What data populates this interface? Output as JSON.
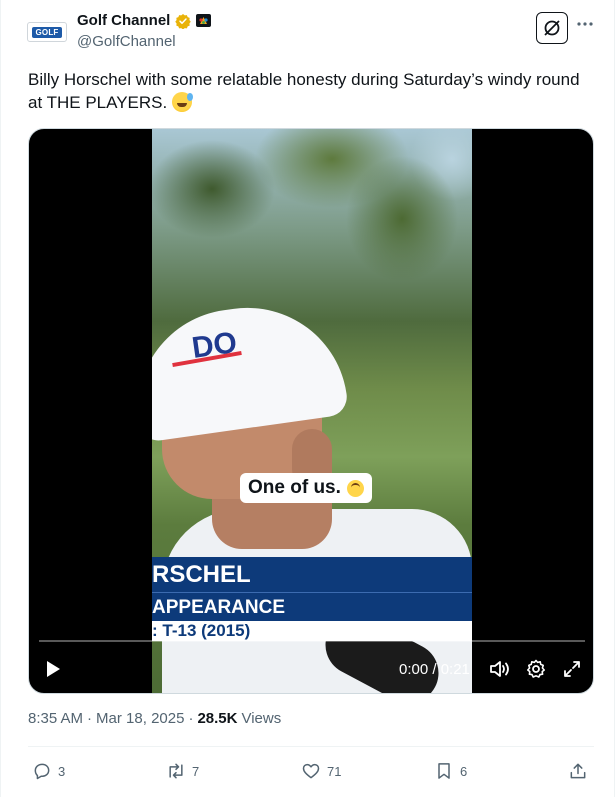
{
  "author": {
    "display_name": "Golf Channel",
    "handle": "@GolfChannel",
    "avatar_label": "GOLF"
  },
  "tweet": {
    "text": "Billy Horschel with some relatable honesty during Saturday’s windy round at THE PLAYERS.",
    "emoji": "sweat-smile"
  },
  "video": {
    "caption": "One of us.",
    "lower_third": {
      "name": "RSCHEL",
      "line2": "APPEARANCE",
      "line3": ": T-13 (2015)"
    },
    "cap_text": "DO",
    "time_display": "0:00 / 0:21",
    "progress_fraction": 0
  },
  "meta": {
    "time": "8:35 AM",
    "separator": "·",
    "date": "Mar 18, 2025",
    "views_count": "28.5K",
    "views_label": "Views"
  },
  "actions": {
    "replies": "3",
    "reposts": "7",
    "likes": "71",
    "bookmarks": "6"
  },
  "colors": {
    "text_primary": "#0f1419",
    "text_secondary": "#536471",
    "verified": "#e9b308",
    "lower_third_blue": "#0d3a7a"
  }
}
